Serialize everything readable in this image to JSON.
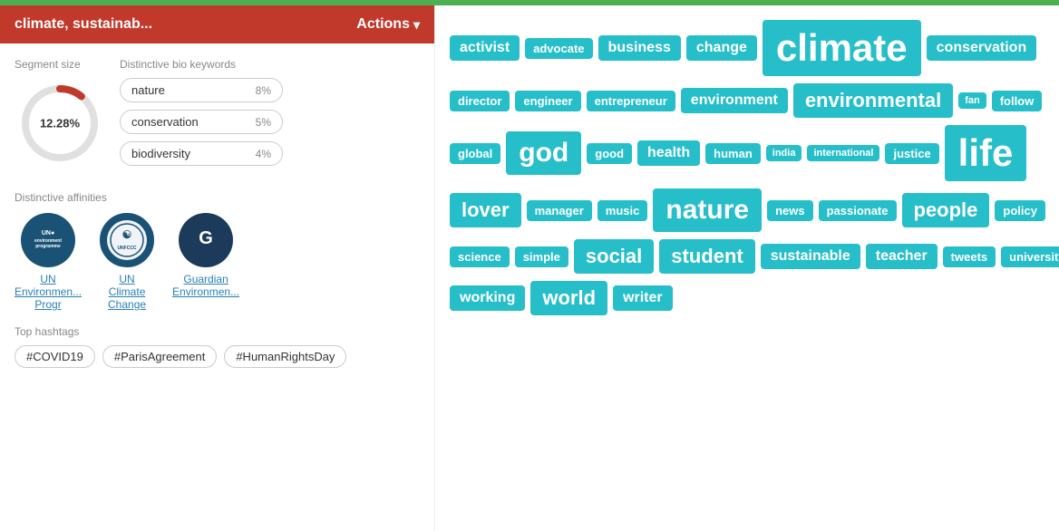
{
  "topBar": {
    "color": "#4caf50"
  },
  "header": {
    "title": "climate, sustainab...",
    "actionsLabel": "Actions"
  },
  "leftPanel": {
    "segmentSize": {
      "label": "Segment size",
      "percentage": "12.28%",
      "filledDeg": 44
    },
    "bioKeywords": {
      "label": "Distinctive bio keywords",
      "items": [
        {
          "name": "nature",
          "pct": "8%"
        },
        {
          "name": "conservation",
          "pct": "5%"
        },
        {
          "name": "biodiversity",
          "pct": "4%"
        }
      ]
    },
    "affinities": {
      "label": "Distinctive affinities",
      "items": [
        {
          "name": "UN Environmen... Progr",
          "type": "un-env"
        },
        {
          "name": "UN Climate Change",
          "type": "un-climate"
        },
        {
          "name": "Guardian Environmen...",
          "type": "guardian"
        }
      ]
    },
    "hashtags": {
      "label": "Top hashtags",
      "items": [
        "#COVID19",
        "#ParisAgreement",
        "#HumanRightsDay"
      ]
    }
  },
  "wordCloud": {
    "rows": [
      [
        {
          "text": "activist",
          "size": "md"
        },
        {
          "text": "advocate",
          "size": "sm"
        },
        {
          "text": "business",
          "size": "md"
        },
        {
          "text": "change",
          "size": "md"
        },
        {
          "text": "climate",
          "size": "xxl"
        },
        {
          "text": "conservation",
          "size": "md"
        }
      ],
      [
        {
          "text": "director",
          "size": "sm"
        },
        {
          "text": "engineer",
          "size": "sm"
        },
        {
          "text": "entrepreneur",
          "size": "sm"
        },
        {
          "text": "environment",
          "size": "md"
        },
        {
          "text": "environmental",
          "size": "lg"
        },
        {
          "text": "fan",
          "size": "xs"
        },
        {
          "text": "follow",
          "size": "sm"
        }
      ],
      [
        {
          "text": "global",
          "size": "sm"
        },
        {
          "text": "god",
          "size": "xl"
        },
        {
          "text": "good",
          "size": "sm"
        },
        {
          "text": "health",
          "size": "md"
        },
        {
          "text": "human",
          "size": "sm"
        },
        {
          "text": "india",
          "size": "xs"
        },
        {
          "text": "international",
          "size": "xs"
        },
        {
          "text": "justice",
          "size": "sm"
        },
        {
          "text": "life",
          "size": "xxl"
        }
      ],
      [
        {
          "text": "lover",
          "size": "lg"
        },
        {
          "text": "manager",
          "size": "sm"
        },
        {
          "text": "music",
          "size": "sm"
        },
        {
          "text": "nature",
          "size": "xl"
        },
        {
          "text": "news",
          "size": "sm"
        },
        {
          "text": "passionate",
          "size": "sm"
        },
        {
          "text": "people",
          "size": "lg"
        },
        {
          "text": "policy",
          "size": "sm"
        }
      ],
      [
        {
          "text": "science",
          "size": "sm"
        },
        {
          "text": "simple",
          "size": "sm"
        },
        {
          "text": "social",
          "size": "lg"
        },
        {
          "text": "student",
          "size": "lg"
        },
        {
          "text": "sustainable",
          "size": "md"
        },
        {
          "text": "teacher",
          "size": "md"
        },
        {
          "text": "tweets",
          "size": "sm"
        },
        {
          "text": "university",
          "size": "sm"
        }
      ],
      [
        {
          "text": "working",
          "size": "md"
        },
        {
          "text": "world",
          "size": "lg"
        },
        {
          "text": "writer",
          "size": "md"
        }
      ]
    ]
  }
}
